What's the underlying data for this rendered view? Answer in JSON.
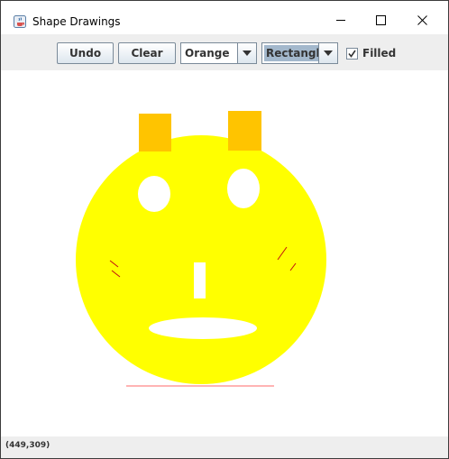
{
  "window": {
    "title": "Shape Drawings",
    "icon": "java-cup-icon"
  },
  "titlebar_controls": {
    "minimize_icon": "minimize-icon",
    "maximize_icon": "maximize-icon",
    "close_icon": "close-icon"
  },
  "toolbar": {
    "undo_label": "Undo",
    "clear_label": "Clear",
    "color_selected": "Orange",
    "shape_selected": "Rectangle",
    "filled_label": "Filled",
    "filled_checked": true
  },
  "drawing": {
    "colors": {
      "face": "#ffff00",
      "ears": "#ffc400",
      "features": "#ffffff",
      "lines": "#ff0000"
    }
  },
  "status": {
    "coords": "(449,309)"
  }
}
